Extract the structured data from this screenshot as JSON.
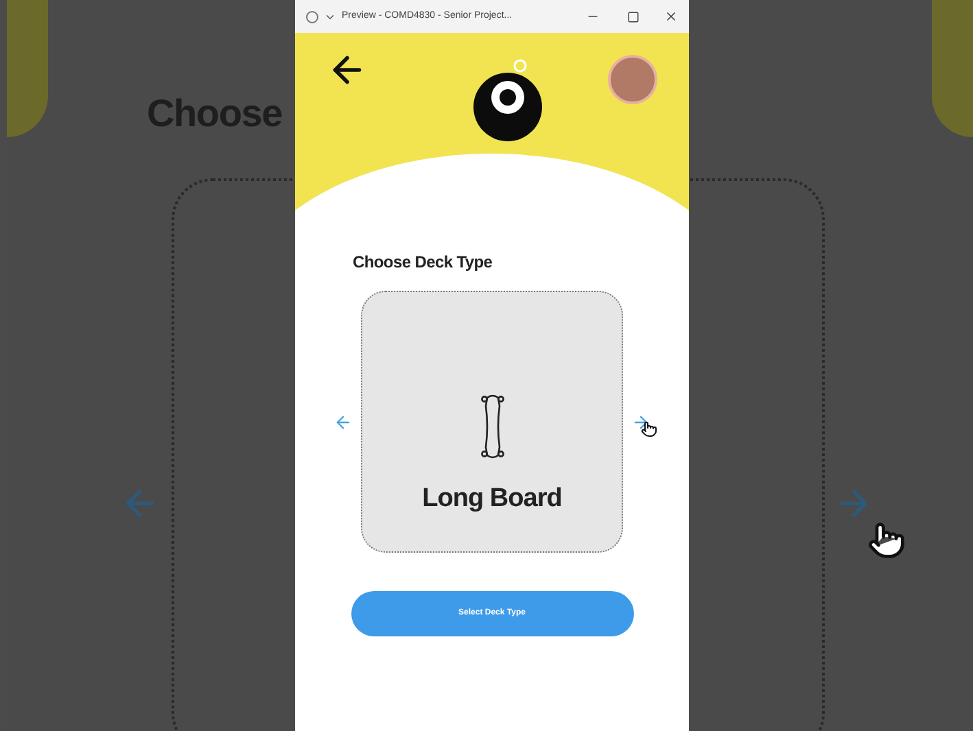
{
  "backdrop": {
    "heading": "Choose"
  },
  "window": {
    "title": "Preview - COMD4830 - Senior Project..."
  },
  "app": {
    "heading": "Choose Deck Type",
    "deck": {
      "name": "Long Board"
    },
    "button": "Select Deck Type"
  }
}
